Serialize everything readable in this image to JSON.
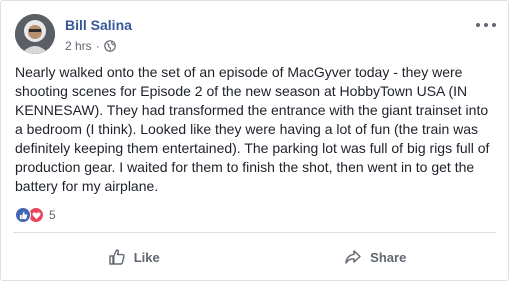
{
  "post": {
    "author": "Bill Salina",
    "time": "2 hrs",
    "separator": "·",
    "privacy_icon": "globe-icon",
    "text": "Nearly walked onto the set of an episode of MacGyver today - they were shooting scenes for Episode 2 of the new season at HobbyTown USA (IN KENNESAW). They had transformed the entrance with the giant trainset into a bedroom (I think). Looked like they were having a lot of fun (the train was definitely keeping them entertained). The parking lot was full of big rigs full of production gear. I waited for them to finish the shot, then went in to get the battery for my airplane."
  },
  "reactions": {
    "icons": [
      "like-reaction-icon",
      "love-reaction-icon"
    ],
    "count": "5"
  },
  "actions": {
    "like_label": "Like",
    "share_label": "Share"
  },
  "colors": {
    "author_link": "#365899",
    "meta_text": "#606770",
    "like_blue": "#4267b2",
    "love_red": "#e9475e"
  }
}
